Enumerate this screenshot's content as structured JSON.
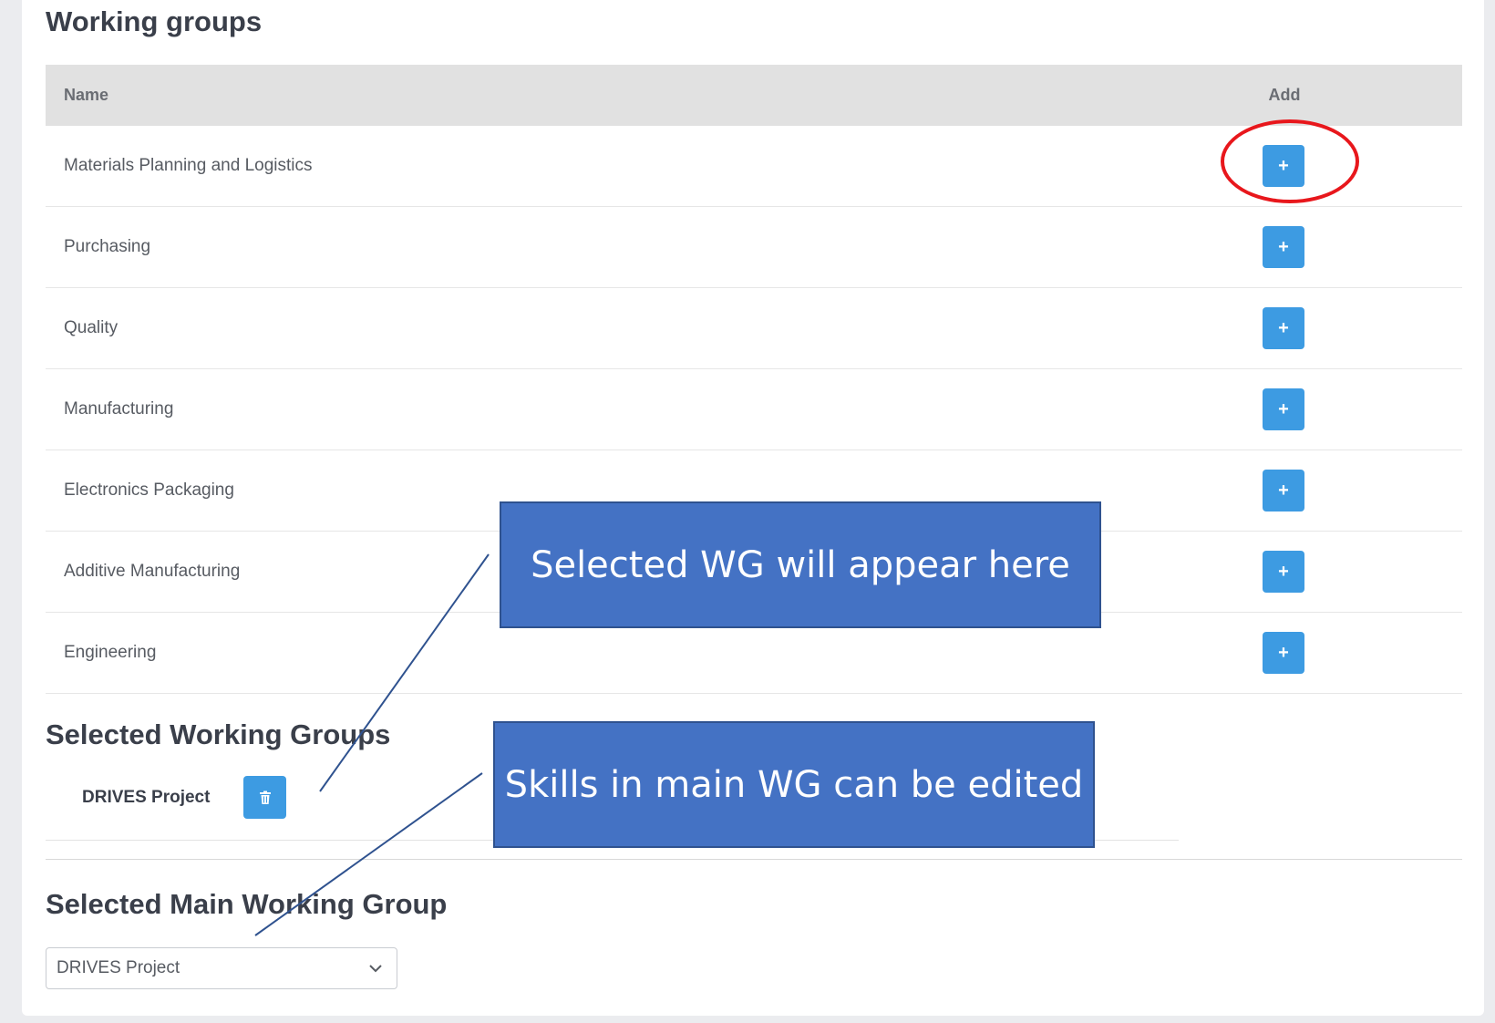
{
  "working_groups": {
    "title": "Working groups",
    "columns": {
      "name": "Name",
      "add": "Add"
    },
    "rows": [
      {
        "name": "Materials Planning and Logistics",
        "add_label": "+"
      },
      {
        "name": "Purchasing",
        "add_label": "+"
      },
      {
        "name": "Quality",
        "add_label": "+"
      },
      {
        "name": "Manufacturing",
        "add_label": "+"
      },
      {
        "name": "Electronics Packaging",
        "add_label": "+"
      },
      {
        "name": "Additive Manufacturing",
        "add_label": "+"
      },
      {
        "name": "Engineering",
        "add_label": "+"
      }
    ]
  },
  "selected_working_groups": {
    "title": "Selected Working Groups",
    "items": [
      {
        "name": "DRIVES Project",
        "remove_icon": "trash-icon"
      }
    ]
  },
  "main_working_group": {
    "title": "Selected Main Working Group",
    "selected_value": "DRIVES Project",
    "dropdown_icon": "chevron-down-icon"
  },
  "annotations": {
    "callout_1": "Selected WG will appear here",
    "callout_2": "Skills in main WG can be edited",
    "highlight_color": "#e8171c",
    "callout_color": "#4472c4"
  },
  "colors": {
    "accent": "#3d9be2",
    "header_bg": "#e1e1e1",
    "text": "#3a3f4a"
  }
}
